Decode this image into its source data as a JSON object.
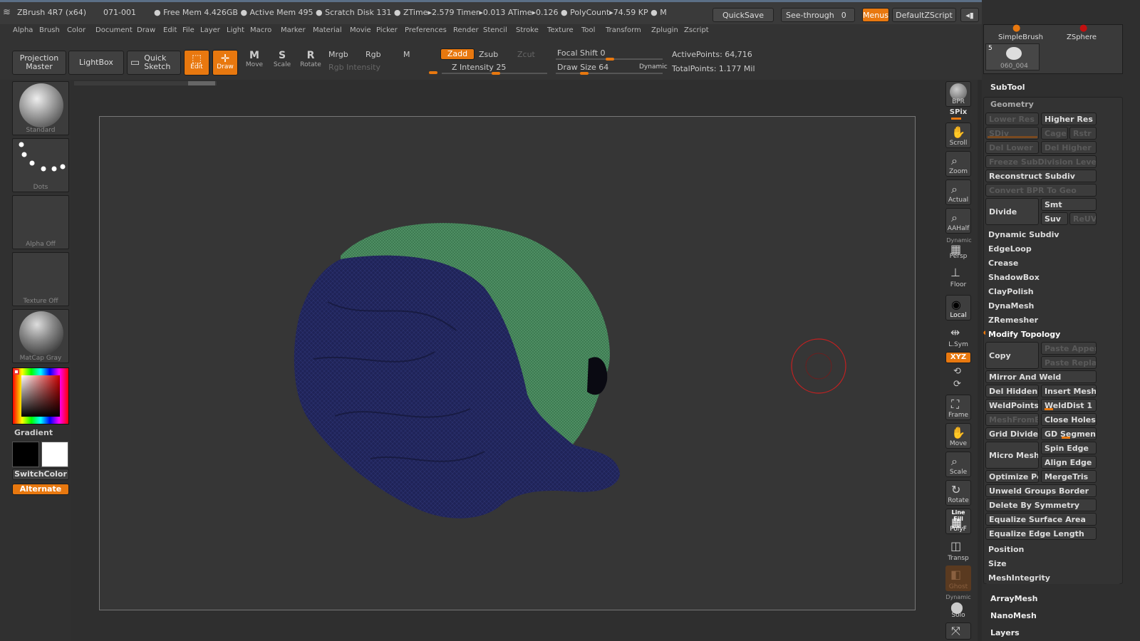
{
  "titlebar": {
    "app": "ZBrush 4R7 (x64)",
    "build": "071-001",
    "stats": "● Free Mem 4.426GB ● Active Mem 495 ● Scratch Disk 131 ● ZTime▸2.579 Timer▸0.013 ATime▸0.126 ● PolyCount▸74.59 KP ● M",
    "quicksave": "QuickSave",
    "see_through": "See-through",
    "see_through_val": "0",
    "menus": "Menus",
    "script": "DefaultZScript"
  },
  "menubar": [
    "Alpha",
    "Brush",
    "Color",
    "Document",
    "Draw",
    "Edit",
    "File",
    "Layer",
    "Light",
    "Macro",
    "Marker",
    "Material",
    "Movie",
    "Picker",
    "Preferences",
    "Render",
    "Stencil",
    "Stroke",
    "Texture",
    "Tool",
    "Transform",
    "Zplugin",
    "Zscript"
  ],
  "shelf": {
    "projection_master": "Projection Master",
    "lightbox": "LightBox",
    "quick_sketch": "Quick Sketch",
    "edit": "Edit",
    "draw": "Draw",
    "move": "Move",
    "scale": "Scale",
    "rotate": "Rotate",
    "mrgb": "Mrgb",
    "rgb": "Rgb",
    "m": "M",
    "rgb_intensity": "Rgb Intensity",
    "zadd": "Zadd",
    "zsub": "Zsub",
    "zcut": "Zcut",
    "z_intensity": "Z Intensity 25",
    "focal_shift": "Focal Shift 0",
    "draw_size": "Draw Size 64",
    "dynamic": "Dynamic",
    "active_points": "ActivePoints: 64,716",
    "total_points": "TotalPoints: 1.177 Mil"
  },
  "leftbar": {
    "standard": "Standard",
    "dots": "Dots",
    "alpha_off": "Alpha Off",
    "texture_off": "Texture Off",
    "matcap": "MatCap Gray",
    "gradient": "Gradient",
    "switchcolor": "SwitchColor",
    "alternate": "Alternate"
  },
  "rightbar": [
    "BPR",
    "SPix",
    "Scroll",
    "Zoom",
    "Actual",
    "AAHalf",
    "Persp",
    "Floor",
    "Local",
    "L.Sym",
    "XYZ",
    "Frame",
    "Move",
    "Scale",
    "Rotate",
    "PolyF",
    "Transp",
    "Ghost",
    "Solo"
  ],
  "rightbar_extra": {
    "dynamic": "Dynamic",
    "line_fill": "Line Fill"
  },
  "panel": {
    "tool_thumbs": [
      "SimpleBrush",
      "ZSphere"
    ],
    "thumb_count": "5",
    "thumb_name": "060_004",
    "subtool": "SubTool",
    "geometry": "Geometry",
    "lower_res": "Lower Res",
    "higher_res": "Higher Res",
    "sdiv": "SDiv",
    "cage": "Cage",
    "rstr": "Rstr",
    "del_lower": "Del Lower",
    "del_higher": "Del Higher",
    "freeze": "Freeze SubDivision Levels",
    "reconstruct": "Reconstruct Subdiv",
    "convert_bpr": "Convert BPR To Geo",
    "divide": "Divide",
    "smt": "Smt",
    "suv": "Suv",
    "reuv": "ReUV",
    "dynamic_subdiv": "Dynamic Subdiv",
    "edgeloop": "EdgeLoop",
    "crease": "Crease",
    "shadowbox": "ShadowBox",
    "claypolish": "ClayPolish",
    "dynamesh": "DynaMesh",
    "zremesher": "ZRemesher",
    "modify_topology": "Modify Topology",
    "copy": "Copy",
    "paste_append": "Paste Append",
    "paste_replace": "Paste Replace",
    "mirror_weld": "Mirror And Weld",
    "del_hidden": "Del Hidden",
    "insert_mesh": "Insert Mesh",
    "weldpoints": "WeldPoints",
    "welddist": "WeldDist 1",
    "meshfrombrush": "MeshFromBrush",
    "close_holes": "Close Holes",
    "grid_divide": "Grid Divide",
    "gd_segments": "GD Segments",
    "spin_edge": "Spin Edge",
    "micro_mesh": "Micro Mesh",
    "align_edge": "Align Edge",
    "optimize": "Optimize Points",
    "mergetris": "MergeTris",
    "unweld": "Unweld Groups Border",
    "delete_sym": "Delete By Symmetry",
    "equalize_area": "Equalize Surface Area",
    "equalize_edge": "Equalize Edge Length",
    "position": "Position",
    "size": "Size",
    "meshintegrity": "MeshIntegrity",
    "arraymesh": "ArrayMesh",
    "nanomesh": "NanoMesh",
    "layers": "Layers"
  },
  "colors": {
    "accent": "#e8780f",
    "mesh_blue": "#1f2358",
    "mesh_green": "#3e7a52",
    "brush_ring": "#c62020"
  }
}
